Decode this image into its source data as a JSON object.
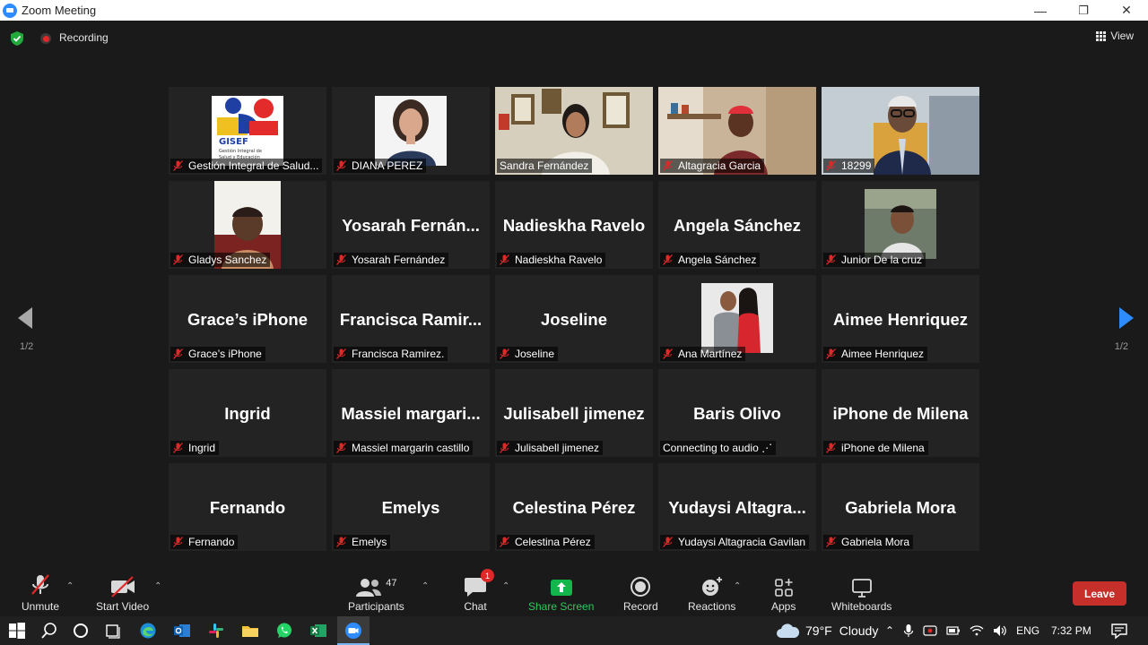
{
  "window": {
    "title": "Zoom Meeting",
    "minimize": "—",
    "restore": "❐",
    "close": "✕"
  },
  "topbar": {
    "recording_label": "Recording",
    "view_label": "View"
  },
  "pagination": {
    "left": "1/2",
    "right": "1/2"
  },
  "participants": [
    {
      "big": "",
      "label": "Gestión Integral de Salud...",
      "muted": true,
      "pic": "logo",
      "active": false
    },
    {
      "big": "",
      "label": "DIANA PEREZ",
      "muted": true,
      "pic": "woman",
      "active": false
    },
    {
      "big": "",
      "label": "Sandra Fernández",
      "muted": false,
      "pic": "office",
      "active": true
    },
    {
      "big": "",
      "label": "Altagracia Garcia",
      "muted": true,
      "pic": "room",
      "active": false
    },
    {
      "big": "",
      "label": "18299",
      "muted": true,
      "pic": "man",
      "active": false
    },
    {
      "big": "",
      "label": "Gladys Sanchez",
      "muted": true,
      "pic": "elder",
      "active": false
    },
    {
      "big": "Yosarah  Fernán...",
      "label": "Yosarah Fernández",
      "muted": true,
      "pic": "",
      "active": false
    },
    {
      "big": "Nadieskha Ravelo",
      "label": "Nadieskha Ravelo",
      "muted": true,
      "pic": "",
      "active": false
    },
    {
      "big": "Angela Sánchez",
      "label": "Angela Sánchez",
      "muted": true,
      "pic": "",
      "active": false
    },
    {
      "big": "",
      "label": "Junior De la cruz",
      "muted": true,
      "pic": "youngman",
      "active": false
    },
    {
      "big": "Grace’s iPhone",
      "label": "Grace’s iPhone",
      "muted": true,
      "pic": "",
      "active": false
    },
    {
      "big": "Francisca  Ramir...",
      "label": "Francisca Ramirez.",
      "muted": true,
      "pic": "",
      "active": false
    },
    {
      "big": "Joseline",
      "label": "Joseline",
      "muted": true,
      "pic": "",
      "active": false
    },
    {
      "big": "",
      "label": "Ana Martínez",
      "muted": true,
      "pic": "couple",
      "active": false
    },
    {
      "big": "Aimee Henriquez",
      "label": "Aimee Henriquez",
      "muted": true,
      "pic": "",
      "active": false
    },
    {
      "big": "Ingrid",
      "label": "Ingrid",
      "muted": true,
      "pic": "",
      "active": false
    },
    {
      "big": "Massiel  margari...",
      "label": "Massiel margarin castillo",
      "muted": true,
      "pic": "",
      "active": false
    },
    {
      "big": "Julisabell jimenez",
      "label": "Julisabell jimenez",
      "muted": true,
      "pic": "",
      "active": false
    },
    {
      "big": "Baris Olivo",
      "label": "Connecting to audio ⋰",
      "muted": false,
      "pic": "",
      "active": false
    },
    {
      "big": "iPhone de Milena",
      "label": "iPhone de Milena",
      "muted": true,
      "pic": "",
      "active": false
    },
    {
      "big": "Fernando",
      "label": "Fernando",
      "muted": true,
      "pic": "",
      "active": false
    },
    {
      "big": "Emelys",
      "label": "Emelys",
      "muted": true,
      "pic": "",
      "active": false
    },
    {
      "big": "Celestina Pérez",
      "label": "Celestina Pérez",
      "muted": true,
      "pic": "",
      "active": false
    },
    {
      "big": "Yudaysi  Altagra...",
      "label": "Yudaysi Altagracia Gavilan",
      "muted": true,
      "pic": "",
      "active": false
    },
    {
      "big": "Gabriela Mora",
      "label": "Gabriela Mora",
      "muted": true,
      "pic": "",
      "active": false
    }
  ],
  "logo_text": {
    "brand": "GISEF",
    "line1": "Gestión Integral de",
    "line2": "Salud y Educación"
  },
  "toolbar": {
    "unmute": "Unmute",
    "start_video": "Start Video",
    "participants": "Participants",
    "participants_count": "47",
    "chat": "Chat",
    "chat_badge": "1",
    "share_screen": "Share Screen",
    "record": "Record",
    "reactions": "Reactions",
    "apps": "Apps",
    "whiteboards": "Whiteboards",
    "leave": "Leave"
  },
  "taskbar": {
    "temperature": "79°F",
    "weather": "Cloudy",
    "language": "ENG",
    "time": "7:32 PM"
  },
  "colors": {
    "accent": "#2d8cff",
    "active_speaker": "#e9e678",
    "muted": "#e02828",
    "share": "#12b64a",
    "leave": "#c7302a"
  }
}
